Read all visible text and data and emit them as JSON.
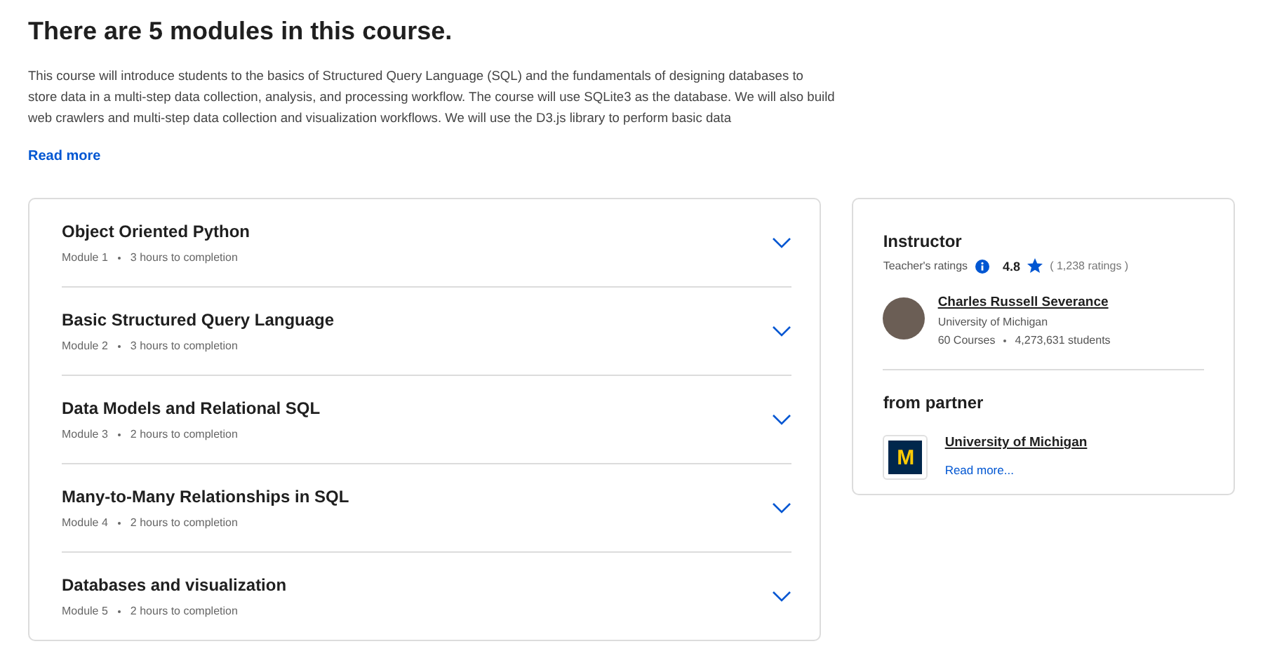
{
  "heading": "There are 5 modules in this course.",
  "description": "This course will introduce students to the basics of Structured Query Language (SQL) and the fundamentals of designing databases to store data in a multi-step data collection, analysis, and processing workflow. The course will use SQLite3 as the database. We will also build web crawlers and multi-step data collection and visualization workflows. We will use the D3.js library to perform basic data",
  "read_more": "Read more",
  "modules": [
    {
      "title": "Object Oriented Python",
      "module": "Module 1",
      "duration": "3 hours to completion",
      "expanded": false
    },
    {
      "title": "Basic Structured Query Language",
      "module": "Module 2",
      "duration": "3 hours to completion",
      "expanded": false
    },
    {
      "title": "Data Models and Relational SQL",
      "module": "Module 3",
      "duration": "2 hours to completion",
      "expanded": false
    },
    {
      "title": "Many-to-Many Relationships in SQL",
      "module": "Module 4",
      "duration": "2 hours to completion",
      "expanded": false
    },
    {
      "title": "Databases and visualization",
      "module": "Module 5",
      "duration": "2 hours to completion",
      "expanded": false
    }
  ],
  "instructor": {
    "heading": "Instructor",
    "ratings_label": "Teacher's ratings",
    "rating": "4.8",
    "ratings_count": "( 1,238 ratings )",
    "name": "Charles Russell Severance",
    "affiliation": "University of Michigan",
    "courses": "60 Courses",
    "students": "4,273,631 students"
  },
  "partner": {
    "heading": "from partner",
    "logo_letter": "M",
    "name": "University of Michigan",
    "read_more": "Read more..."
  }
}
